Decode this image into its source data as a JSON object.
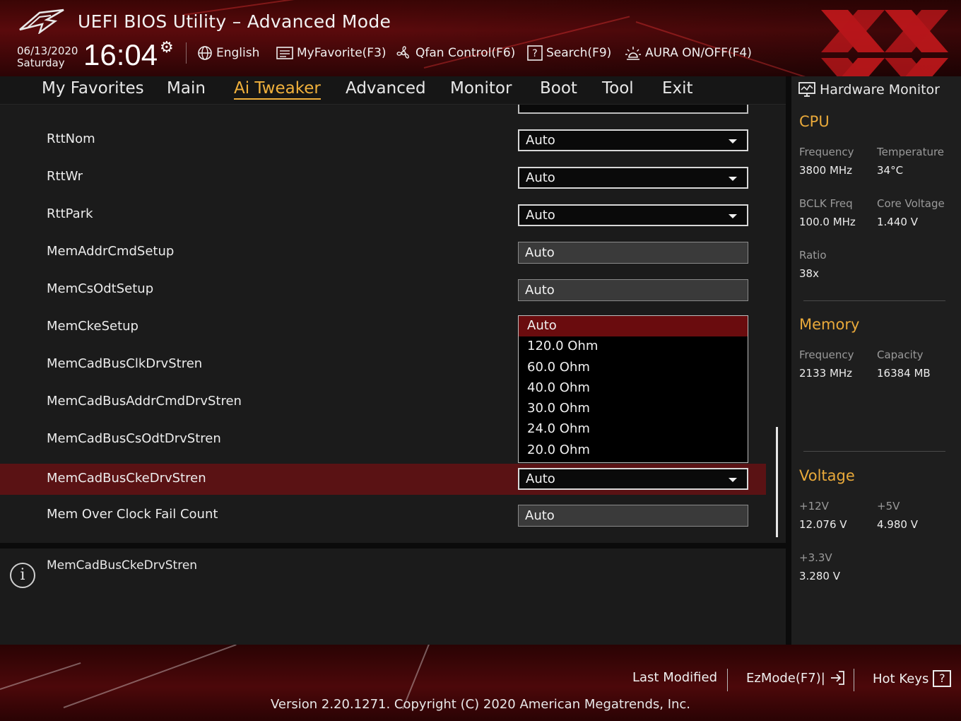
{
  "header": {
    "title": "UEFI BIOS Utility – Advanced Mode",
    "date": "06/13/2020",
    "day": "Saturday",
    "time": "16:04",
    "tools": [
      {
        "label": "English",
        "icon": "globe-icon"
      },
      {
        "label": "MyFavorite(F3)",
        "icon": "favorite-list-icon"
      },
      {
        "label": "Qfan Control(F6)",
        "icon": "fan-icon"
      },
      {
        "label": "Search(F9)",
        "icon": "search-help-icon"
      },
      {
        "label": "AURA ON/OFF(F4)",
        "icon": "aura-light-icon"
      }
    ]
  },
  "tabs": [
    {
      "label": "My Favorites"
    },
    {
      "label": "Main"
    },
    {
      "label": "Ai Tweaker",
      "active": true
    },
    {
      "label": "Advanced"
    },
    {
      "label": "Monitor"
    },
    {
      "label": "Boot"
    },
    {
      "label": "Tool"
    },
    {
      "label": "Exit"
    }
  ],
  "settings": [
    {
      "label": "RttNom",
      "value": "Auto",
      "type": "dropdown"
    },
    {
      "label": "RttWr",
      "value": "Auto",
      "type": "dropdown"
    },
    {
      "label": "RttPark",
      "value": "Auto",
      "type": "dropdown"
    },
    {
      "label": "MemAddrCmdSetup",
      "value": "Auto",
      "type": "readonly"
    },
    {
      "label": "MemCsOdtSetup",
      "value": "Auto",
      "type": "readonly"
    },
    {
      "label": "MemCkeSetup",
      "value": "",
      "type": "none"
    },
    {
      "label": "MemCadBusClkDrvStren",
      "value": "",
      "type": "none"
    },
    {
      "label": "MemCadBusAddrCmdDrvStren",
      "value": "",
      "type": "none"
    },
    {
      "label": "MemCadBusCsOdtDrvStren",
      "value": "",
      "type": "none"
    },
    {
      "label": "MemCadBusCkeDrvStren",
      "value": "Auto",
      "type": "dropdown",
      "selected": true
    },
    {
      "label": "Mem Over Clock Fail Count",
      "value": "Auto",
      "type": "readonly"
    }
  ],
  "dropdown_options": [
    "Auto",
    "120.0 Ohm",
    "60.0 Ohm",
    "40.0 Ohm",
    "30.0 Ohm",
    "24.0 Ohm",
    "20.0 Ohm"
  ],
  "dropdown_selected": "Auto",
  "help": {
    "text": "MemCadBusCkeDrvStren"
  },
  "hardware_monitor": {
    "title": "Hardware Monitor",
    "cpu": {
      "heading": "CPU",
      "frequency_label": "Frequency",
      "frequency": "3800 MHz",
      "temperature_label": "Temperature",
      "temperature": "34°C",
      "bclk_label": "BCLK Freq",
      "bclk": "100.0 MHz",
      "core_voltage_label": "Core Voltage",
      "core_voltage": "1.440 V",
      "ratio_label": "Ratio",
      "ratio": "38x"
    },
    "memory": {
      "heading": "Memory",
      "frequency_label": "Frequency",
      "frequency": "2133 MHz",
      "capacity_label": "Capacity",
      "capacity": "16384 MB"
    },
    "voltage": {
      "heading": "Voltage",
      "v12_label": "+12V",
      "v12": "12.076 V",
      "v5_label": "+5V",
      "v5": "4.980 V",
      "v33_label": "+3.3V",
      "v33": "3.280 V"
    }
  },
  "footer": {
    "last_modified": "Last Modified",
    "ezmode": "EzMode(F7)|",
    "hotkeys": "Hot Keys",
    "hotkeys_key": "?",
    "version": "Version 2.20.1271. Copyright (C) 2020 American Megatrends, Inc."
  },
  "colors": {
    "accent": "#f1b13c",
    "selected_row": "#5a1214",
    "dropdown_selected": "#6a0c0e",
    "header_red": "#5a0a0c"
  }
}
